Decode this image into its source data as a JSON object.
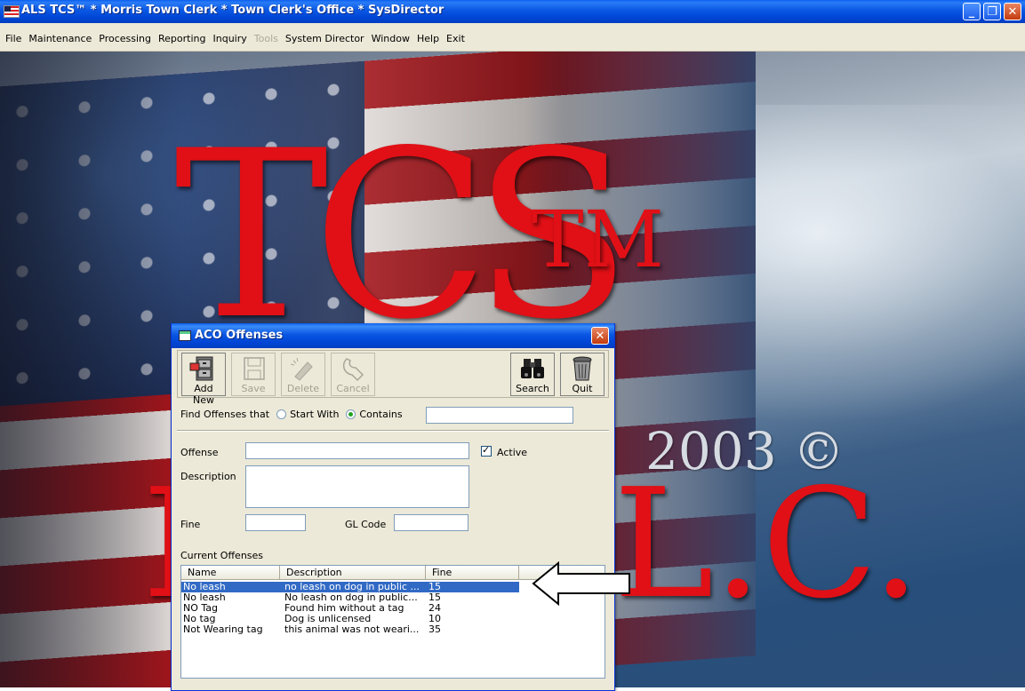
{
  "window": {
    "title": "ALS TCS™ * Morris Town Clerk * Town Clerk's Office * SysDirector",
    "minimize": "_",
    "restore": "❐",
    "close": "✕"
  },
  "menu": [
    {
      "label": "File",
      "enabled": true
    },
    {
      "label": "Maintenance",
      "enabled": true
    },
    {
      "label": "Processing",
      "enabled": true
    },
    {
      "label": "Reporting",
      "enabled": true
    },
    {
      "label": "Inquiry",
      "enabled": true
    },
    {
      "label": "Tools",
      "enabled": false
    },
    {
      "label": "System Director",
      "enabled": true
    },
    {
      "label": "Window",
      "enabled": true
    },
    {
      "label": "Help",
      "enabled": true
    },
    {
      "label": "Exit",
      "enabled": true
    }
  ],
  "background": {
    "brand": "TCS",
    "tm": "TM",
    "year": "2003 ©",
    "llc_left": "I",
    "llc_right": "L.C."
  },
  "dialog": {
    "title": "ACO Offenses",
    "close": "✕",
    "toolbar": {
      "add_new": "Add New",
      "save": "Save",
      "delete": "Delete",
      "cancel": "Cancel",
      "search": "Search",
      "quit": "Quit"
    },
    "find": {
      "label": "Find Offenses that",
      "start_with": "Start With",
      "contains": "Contains",
      "selected": "contains",
      "value": ""
    },
    "form": {
      "offense_label": "Offense",
      "offense_value": "",
      "active_label": "Active",
      "active_checked": true,
      "description_label": "Description",
      "description_value": "",
      "fine_label": "Fine",
      "fine_value": "",
      "gl_code_label": "GL Code",
      "gl_code_value": ""
    },
    "current_offenses": {
      "label": "Current Offenses",
      "columns": [
        "Name",
        "Description",
        "Fine"
      ],
      "rows": [
        {
          "name": "No leash",
          "description": "no leash on dog in public ...",
          "fine": "15",
          "selected": true
        },
        {
          "name": "No leash",
          "description": "No leash on dog in public...",
          "fine": "15",
          "selected": false
        },
        {
          "name": "NO Tag",
          "description": "Found him without a tag",
          "fine": "24",
          "selected": false
        },
        {
          "name": "No tag",
          "description": "Dog is unlicensed",
          "fine": "10",
          "selected": false
        },
        {
          "name": "Not Wearing tag",
          "description": "this animal was not weari...",
          "fine": "35",
          "selected": false
        }
      ]
    }
  },
  "colors": {
    "titlebar": "#0a57e3",
    "selection": "#316ac5",
    "logo_red": "#e01016"
  }
}
